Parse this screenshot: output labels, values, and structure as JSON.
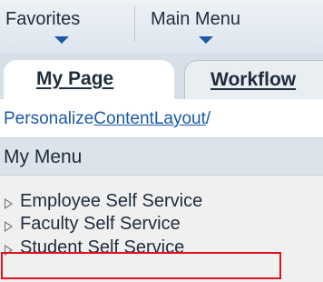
{
  "topnav": {
    "favorites_label": "Favorites",
    "main_menu_label": "Main Menu"
  },
  "tabs": [
    {
      "label": "My Page",
      "active": true
    },
    {
      "label": "Workflow",
      "active": false
    }
  ],
  "personalize": {
    "link1": "Personalize",
    "link2": "Content",
    "link3": "Layout",
    "separator": "/"
  },
  "menu": {
    "title": "My Menu",
    "items": [
      {
        "label": "Employee Self Service",
        "icon": "triangle-right-icon"
      },
      {
        "label": "Faculty Self Service",
        "icon": "triangle-right-icon"
      },
      {
        "label": "Student Self Service",
        "icon": "triangle-right-icon",
        "highlighted": true
      }
    ]
  },
  "colors": {
    "link": "#1a5aa8",
    "highlight": "#e3101d"
  }
}
